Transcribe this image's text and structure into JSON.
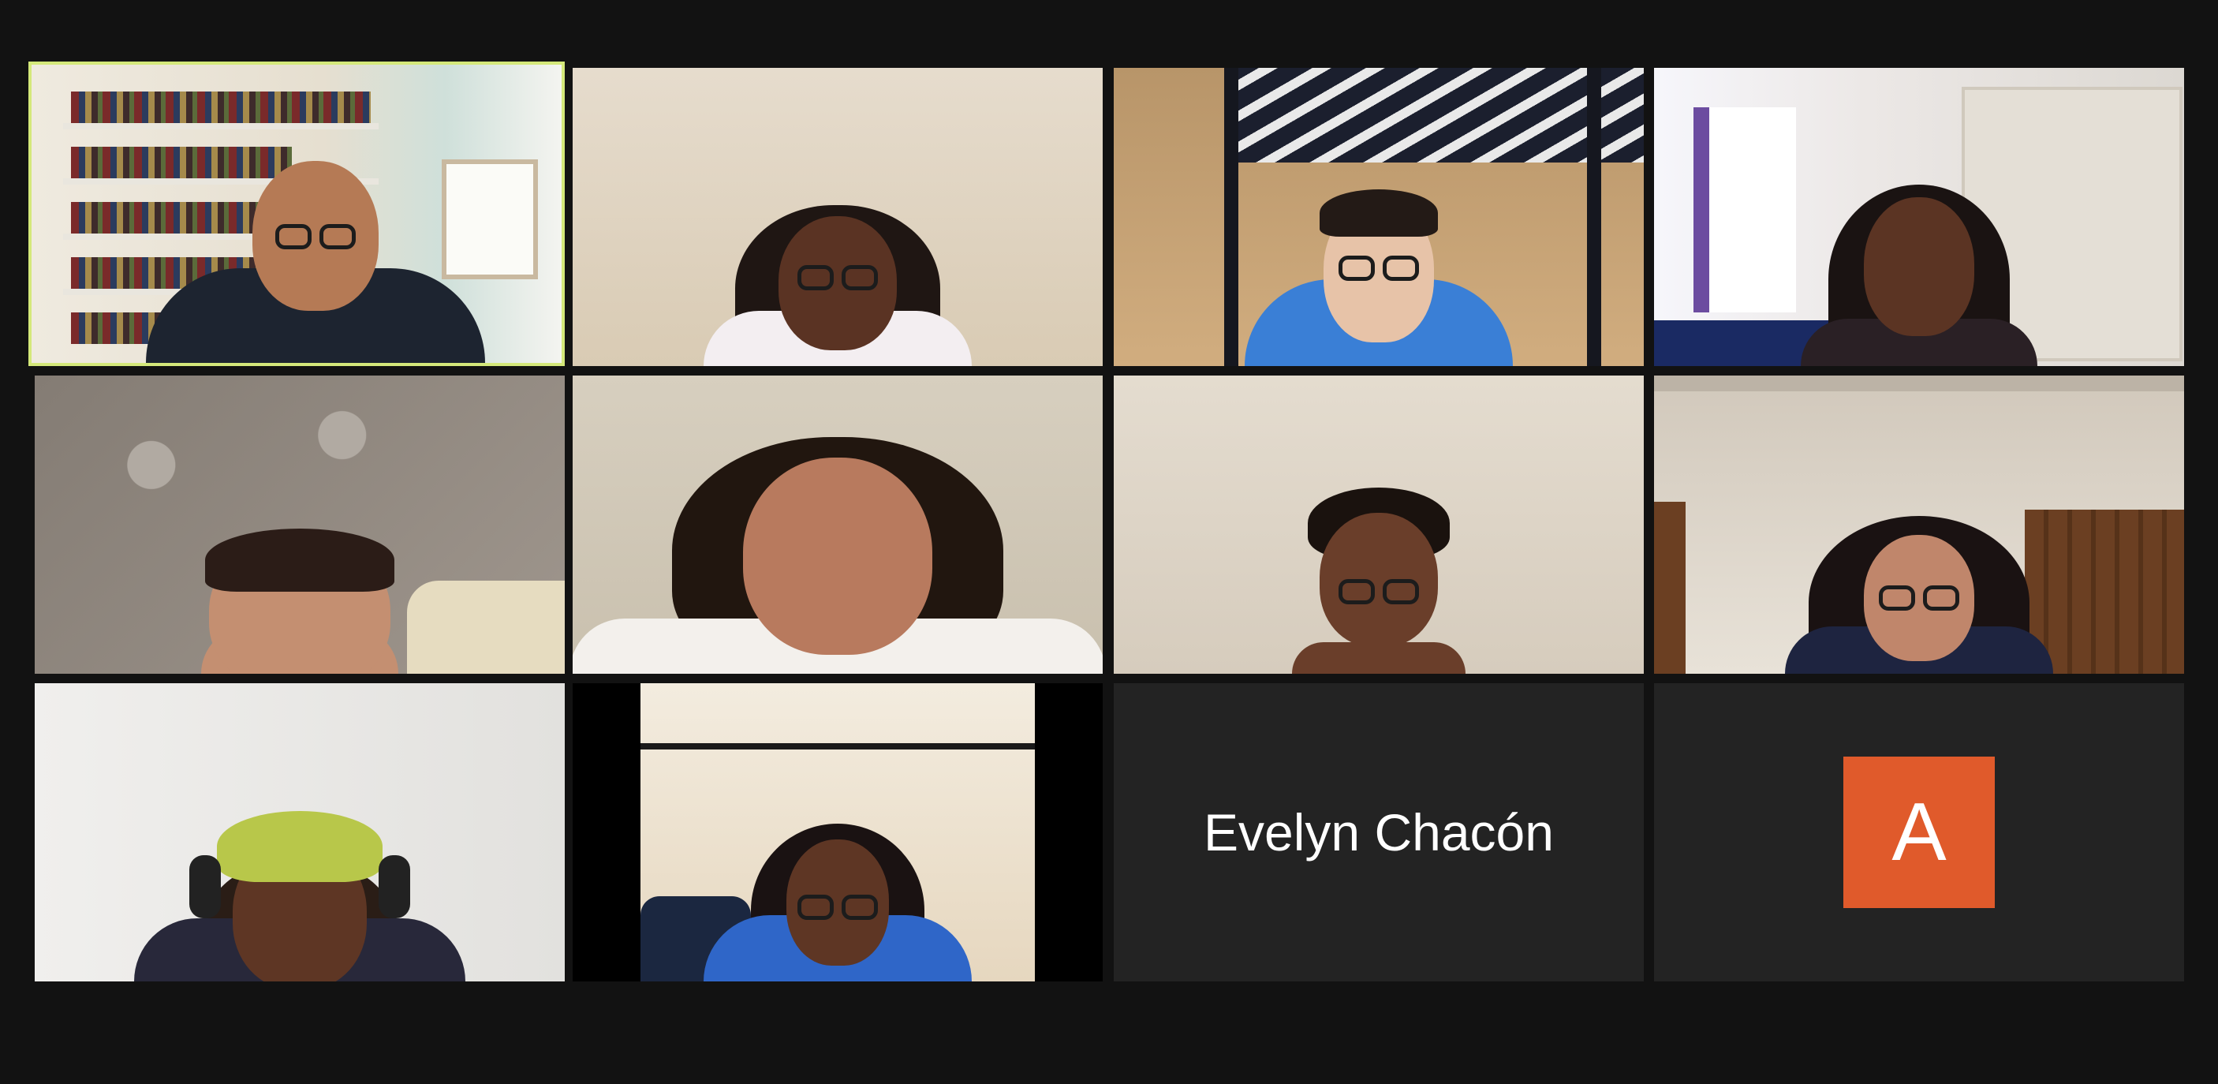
{
  "meeting": {
    "view": "gallery",
    "active_speaker_color": "#d4e87a"
  },
  "tiles": [
    {
      "kind": "video",
      "icon": "participant-video"
    },
    {
      "kind": "video",
      "icon": "participant-video"
    },
    {
      "kind": "video",
      "icon": "participant-video"
    },
    {
      "kind": "video",
      "icon": "participant-video"
    },
    {
      "kind": "video",
      "icon": "participant-video"
    },
    {
      "kind": "video",
      "icon": "participant-video"
    },
    {
      "kind": "video",
      "icon": "participant-video"
    },
    {
      "kind": "video",
      "icon": "participant-video"
    },
    {
      "kind": "video",
      "icon": "participant-video"
    },
    {
      "kind": "video",
      "icon": "participant-video"
    },
    {
      "kind": "name",
      "name": "Evelyn Chacón"
    },
    {
      "kind": "avatar",
      "initial": "A",
      "avatar_color": "#e05a2b"
    }
  ]
}
